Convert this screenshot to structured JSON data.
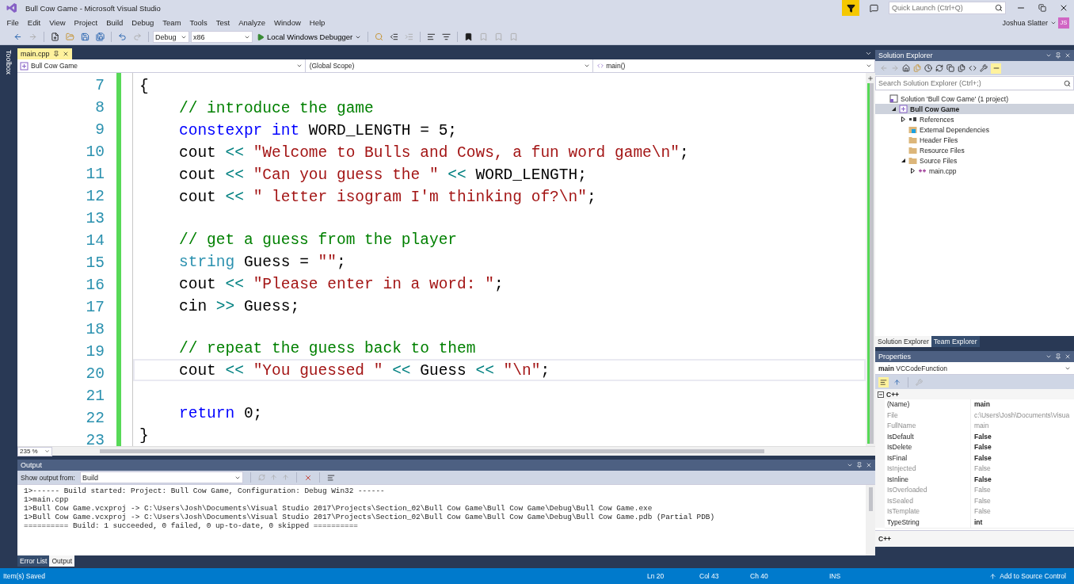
{
  "window": {
    "title": "Bull Cow Game - Microsoft Visual Studio",
    "user": "Joshua Slatter",
    "avatar": "JS",
    "quick_launch": {
      "placeholder": "Quick Launch (Ctrl+Q)"
    }
  },
  "menu": [
    "File",
    "Edit",
    "View",
    "Project",
    "Build",
    "Debug",
    "Team",
    "Tools",
    "Test",
    "Analyze",
    "Window",
    "Help"
  ],
  "toolbar": {
    "configuration": "Debug",
    "platform": "x86",
    "debugger": "Local Windows Debugger"
  },
  "toolbox": {
    "label": "Toolbox"
  },
  "editor": {
    "tabs": [
      {
        "label": "main.cpp",
        "selected": true
      }
    ],
    "nav": [
      "Bull Cow Game",
      "(Global Scope)",
      "main()"
    ],
    "zoom": "235 %",
    "lines": [
      {
        "number": "7",
        "indented": false,
        "current": false,
        "tokens": [
          {
            "kind": "plain",
            "text": "{"
          }
        ]
      },
      {
        "number": "8",
        "indented": true,
        "current": false,
        "tokens": [
          {
            "kind": "comment",
            "text": "// introduce the game"
          }
        ]
      },
      {
        "number": "9",
        "indented": true,
        "current": false,
        "tokens": [
          {
            "kind": "keyword",
            "text": "constexpr "
          },
          {
            "kind": "keyword",
            "text": "int"
          },
          {
            "kind": "plain",
            "text": " WORD_LENGTH = 5;"
          }
        ]
      },
      {
        "number": "10",
        "indented": true,
        "current": false,
        "tokens": [
          {
            "kind": "plain",
            "text": "cout "
          },
          {
            "kind": "operator",
            "text": "<< "
          },
          {
            "kind": "string",
            "text": "\"Welcome to Bulls and Cows, a fun word game\\n\""
          },
          {
            "kind": "plain",
            "text": ";"
          }
        ]
      },
      {
        "number": "11",
        "indented": true,
        "current": false,
        "tokens": [
          {
            "kind": "plain",
            "text": "cout "
          },
          {
            "kind": "operator",
            "text": "<< "
          },
          {
            "kind": "string",
            "text": "\"Can you guess the \""
          },
          {
            "kind": "operator",
            "text": " << "
          },
          {
            "kind": "plain",
            "text": "WORD_LENGTH;"
          }
        ]
      },
      {
        "number": "12",
        "indented": true,
        "current": false,
        "tokens": [
          {
            "kind": "plain",
            "text": "cout "
          },
          {
            "kind": "operator",
            "text": "<< "
          },
          {
            "kind": "string",
            "text": "\" letter isogram I'm thinking of?\\n\""
          },
          {
            "kind": "plain",
            "text": ";"
          }
        ]
      },
      {
        "number": "13"
      },
      {
        "number": "14",
        "indented": true,
        "current": false,
        "tokens": [
          {
            "kind": "comment",
            "text": "// get a guess from the player"
          }
        ]
      },
      {
        "number": "15",
        "indented": true,
        "current": false,
        "tokens": [
          {
            "kind": "type",
            "text": "string"
          },
          {
            "kind": "plain",
            "text": " Guess = "
          },
          {
            "kind": "string",
            "text": "\"\""
          },
          {
            "kind": "plain",
            "text": ";"
          }
        ]
      },
      {
        "number": "16",
        "indented": true,
        "current": false,
        "tokens": [
          {
            "kind": "plain",
            "text": "cout "
          },
          {
            "kind": "operator",
            "text": "<< "
          },
          {
            "kind": "string",
            "text": "\"Please enter in a word: \""
          },
          {
            "kind": "plain",
            "text": ";"
          }
        ]
      },
      {
        "number": "17",
        "indented": true,
        "current": false,
        "tokens": [
          {
            "kind": "plain",
            "text": "cin "
          },
          {
            "kind": "operator",
            "text": ">>"
          },
          {
            "kind": "plain",
            "text": " Guess;"
          }
        ]
      },
      {
        "number": "18"
      },
      {
        "number": "19",
        "indented": true,
        "current": false,
        "tokens": [
          {
            "kind": "comment",
            "text": "// repeat the guess back to them"
          }
        ]
      },
      {
        "number": "20",
        "indented": true,
        "current": true,
        "tokens": [
          {
            "kind": "plain",
            "text": "cout "
          },
          {
            "kind": "operator",
            "text": "<< "
          },
          {
            "kind": "string",
            "text": "\"You guessed \""
          },
          {
            "kind": "operator",
            "text": " << "
          },
          {
            "kind": "plain",
            "text": "Guess "
          },
          {
            "kind": "operator",
            "text": "<< "
          },
          {
            "kind": "string",
            "text": "\"\\n\""
          },
          {
            "kind": "plain",
            "text": ";"
          }
        ]
      },
      {
        "number": "21"
      },
      {
        "number": "22",
        "indented": true,
        "current": false,
        "tokens": [
          {
            "kind": "keyword",
            "text": "return"
          },
          {
            "kind": "plain",
            "text": " 0;"
          }
        ]
      },
      {
        "number": "23",
        "indented": false,
        "current": false,
        "tokens": [
          {
            "kind": "plain",
            "text": "}"
          }
        ]
      }
    ]
  },
  "output": {
    "title": "Output",
    "source_label": "Show output from:",
    "source": "Build",
    "lines": [
      "1>------ Build started: Project: Bull Cow Game, Configuration: Debug Win32 ------",
      "1>main.cpp",
      "1>Bull Cow Game.vcxproj -> C:\\Users\\Josh\\Documents\\Visual Studio 2017\\Projects\\Section_02\\Bull Cow Game\\Bull Cow Game\\Debug\\Bull Cow Game.exe",
      "1>Bull Cow Game.vcxproj -> C:\\Users\\Josh\\Documents\\Visual Studio 2017\\Projects\\Section_02\\Bull Cow Game\\Bull Cow Game\\Debug\\Bull Cow Game.pdb (Partial PDB)",
      "========== Build: 1 succeeded, 0 failed, 0 up-to-date, 0 skipped =========="
    ],
    "tabs": [
      {
        "label": "Error List",
        "selected": false
      },
      {
        "label": "Output",
        "selected": true
      }
    ]
  },
  "solution_explorer": {
    "title": "Solution Explorer",
    "search": {
      "placeholder": "Search Solution Explorer (Ctrl+;)"
    },
    "tree": [
      {
        "label": "Solution 'Bull Cow Game' (1 project)",
        "kind": "solution",
        "selected": false,
        "children": [
          {
            "label": "Bull Cow Game",
            "kind": "project",
            "selected": true,
            "expanded": true,
            "children": [
              {
                "label": "References",
                "kind": "references",
                "selected": false,
                "expanded": false
              },
              {
                "label": "External Dependencies",
                "kind": "external",
                "selected": false
              },
              {
                "label": "Header Files",
                "kind": "folder",
                "selected": false
              },
              {
                "label": "Resource Files",
                "kind": "folder",
                "selected": false
              },
              {
                "label": "Source Files",
                "kind": "folder",
                "selected": false,
                "expanded": true,
                "children": [
                  {
                    "label": "main.cpp",
                    "kind": "cpp",
                    "selected": false,
                    "expanded": false
                  }
                ]
              }
            ]
          }
        ]
      }
    ],
    "tabs": [
      {
        "label": "Solution Explorer",
        "selected": true
      },
      {
        "label": "Team Explorer",
        "selected": false
      }
    ]
  },
  "properties": {
    "title": "Properties",
    "object": "main",
    "object_type": "VCCodeFunction",
    "category": {
      "label": "C++",
      "expanded": true
    },
    "rows": [
      {
        "name": "(Name)",
        "value": "main",
        "readonly": false
      },
      {
        "name": "File",
        "value": "c:\\Users\\Josh\\Documents\\Visua",
        "readonly": true
      },
      {
        "name": "FullName",
        "value": "main",
        "readonly": true
      },
      {
        "name": "IsDefault",
        "value": "False",
        "readonly": false
      },
      {
        "name": "IsDelete",
        "value": "False",
        "readonly": false
      },
      {
        "name": "IsFinal",
        "value": "False",
        "readonly": false
      },
      {
        "name": "IsInjected",
        "value": "False",
        "readonly": true
      },
      {
        "name": "IsInline",
        "value": "False",
        "readonly": false
      },
      {
        "name": "IsOverloaded",
        "value": "False",
        "readonly": true
      },
      {
        "name": "IsSealed",
        "value": "False",
        "readonly": true
      },
      {
        "name": "IsTemplate",
        "value": "False",
        "readonly": true
      },
      {
        "name": "TypeString",
        "value": "int",
        "readonly": false
      }
    ],
    "description": "C++"
  },
  "status_bar": {
    "message": "Item(s) Saved",
    "line": "Ln 20",
    "column": "Col 43",
    "char": "Ch 40",
    "mode": "INS",
    "source_control": "Add to Source Control"
  }
}
